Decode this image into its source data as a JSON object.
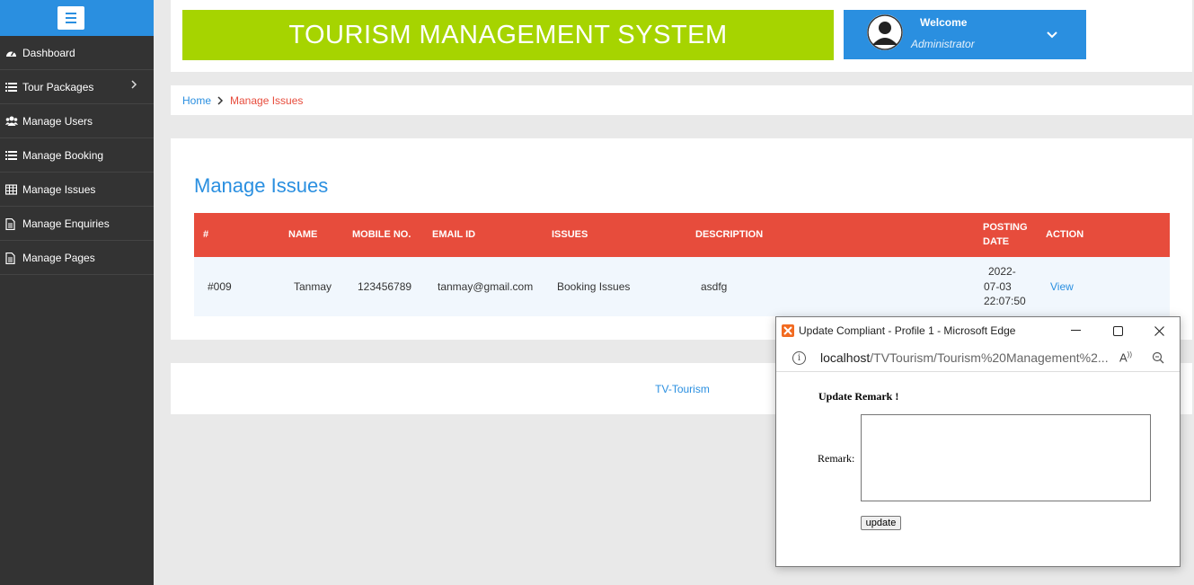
{
  "sidebar": {
    "items": [
      {
        "label": "Dashboard",
        "icon": "dashboard-icon"
      },
      {
        "label": "Tour Packages",
        "icon": "list-icon"
      },
      {
        "label": "Manage Users",
        "icon": "users-icon"
      },
      {
        "label": "Manage Booking",
        "icon": "list-icon"
      },
      {
        "label": "Manage Issues",
        "icon": "table-icon"
      },
      {
        "label": "Manage Enquiries",
        "icon": "file-icon"
      },
      {
        "label": "Manage Pages",
        "icon": "file-icon"
      }
    ]
  },
  "header": {
    "title": "TOURISM MANAGEMENT SYSTEM",
    "welcome": "Welcome",
    "role": "Administrator"
  },
  "breadcrumb": {
    "home": "Home",
    "current": "Manage Issues"
  },
  "main": {
    "title": "Manage Issues",
    "columns": [
      "#",
      "NAME",
      "MOBILE NO.",
      "EMAIL ID",
      "ISSUES",
      "DESCRIPTION",
      "POSTING",
      "DATE",
      "ACTION"
    ],
    "rows": [
      {
        "id": "#009",
        "name": "Tanmay",
        "mobile": "123456789",
        "email": "tanmay@gmail.com",
        "issue": "Booking Issues",
        "description": "asdfg",
        "date_line1": "2022-",
        "date_line2": "07-03",
        "date_line3": "22:07:50",
        "action": "View"
      }
    ]
  },
  "footer": {
    "text": "TV-Tourism"
  },
  "popup": {
    "window_title": "Update Compliant - Profile 1 - Microsoft Edge",
    "url_host": "localhost",
    "url_path": "/TVTourism/Tourism%20Management%2...",
    "heading": "Update Remark !",
    "remark_label": "Remark:",
    "remark_value": "",
    "button_label": "update"
  },
  "colors": {
    "accent": "#2a8fe0",
    "banner": "#a6d400",
    "table_header": "#e74c3c",
    "sidebar": "#333333"
  }
}
